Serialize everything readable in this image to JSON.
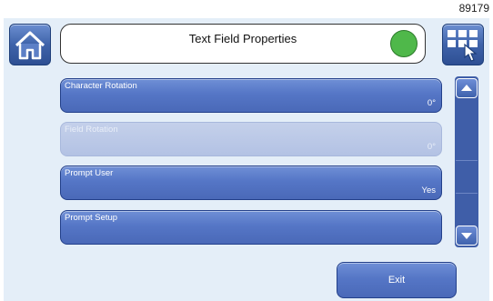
{
  "screen_id": "89179",
  "header": {
    "title": "Text Field Properties",
    "status_color": "#4fb84a",
    "home_icon": "home-icon",
    "menu_icon": "grid-menu-icon"
  },
  "rows": [
    {
      "label": "Character Rotation",
      "value": "0°",
      "enabled": true
    },
    {
      "label": "Field Rotation",
      "value": "0°",
      "enabled": false
    },
    {
      "label": "Prompt User",
      "value": "Yes",
      "enabled": true
    },
    {
      "label": "Prompt Setup",
      "value": "",
      "enabled": true
    }
  ],
  "scrollbar": {
    "up_icon": "triangle-up-icon",
    "down_icon": "triangle-down-icon"
  },
  "footer": {
    "exit_label": "Exit"
  },
  "colors": {
    "accent": "#4a69b8",
    "panel": "#e4eef8"
  }
}
